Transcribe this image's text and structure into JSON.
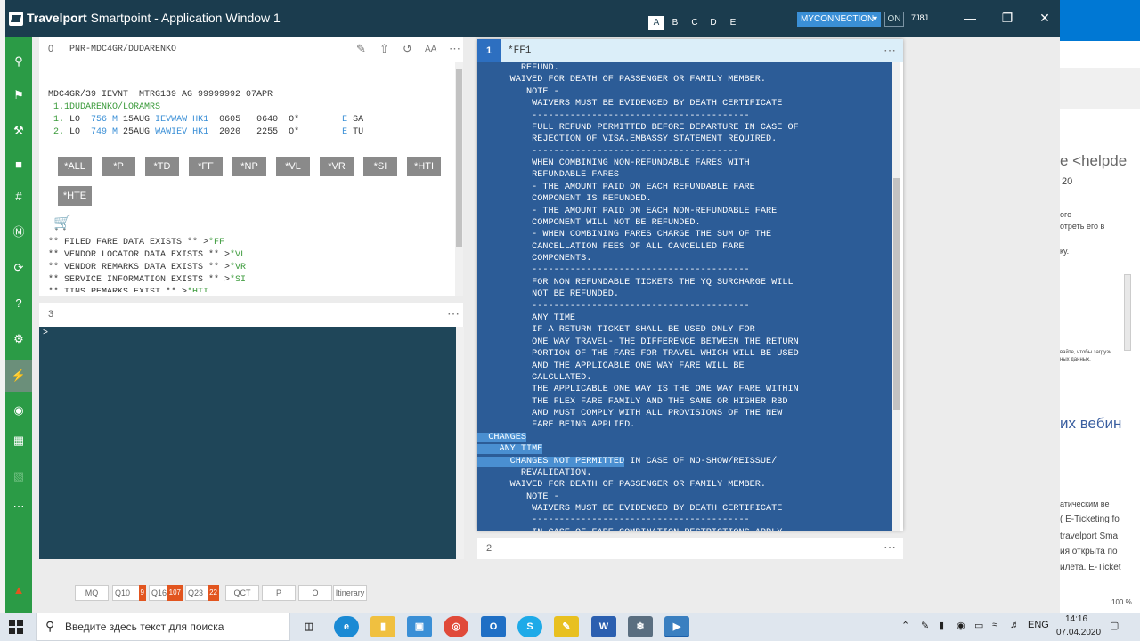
{
  "window": {
    "title_bold": "Travelport",
    "title_rest": " Smartpoint - Application Window 1",
    "workspaces": [
      "A",
      "B",
      "C",
      "D",
      "E"
    ],
    "connection": "MYCONNECTION",
    "on_label": "ON",
    "session_id": "7J8J"
  },
  "panel0": {
    "number": "0",
    "title": "PNR-MDC4GR/DUDARENKO",
    "header_line": "MDC4GR/39 IEVNT  MTRG139 AG 99999992 07APR",
    "passenger": " 1.1DUDARENKO/LORAMRS",
    "segments": [
      {
        "num": " 1.",
        "carrier": "LO",
        "flight": "756 M",
        "date": "15AUG",
        "route": "IEVWAW",
        "status": "HK1",
        "dep": "0605",
        "arr": "0640",
        "o": "O*",
        "e": "E",
        "day": "SA"
      },
      {
        "num": " 2.",
        "carrier": "LO",
        "flight": "749 M",
        "date": "25AUG",
        "route": "WAWIEV",
        "status": "HK1",
        "dep": "2020",
        "arr": "2255",
        "o": "O*",
        "e": "E",
        "day": "TU"
      }
    ],
    "buttons": [
      "*ALL",
      "*P",
      "*TD",
      "*FF",
      "*NP",
      "*VL",
      "*VR",
      "*SI",
      "*HTI",
      "*HTE"
    ],
    "notes": [
      {
        "text": "** FILED FARE DATA EXISTS ** >",
        "link": "*FF"
      },
      {
        "text": "** VENDOR LOCATOR DATA EXISTS ** >",
        "link": "*VL"
      },
      {
        "text": "** VENDOR REMARKS DATA EXISTS ** >",
        "link": "*VR"
      },
      {
        "text": "** SERVICE INFORMATION EXISTS ** >",
        "link": "*SI"
      },
      {
        "text": "** TINS REMARKS EXIST ** >",
        "link": "*HTI"
      }
    ]
  },
  "panel3": {
    "number": "3",
    "prompt": ">"
  },
  "panel1": {
    "number": "1",
    "title": "*FF1",
    "lines": [
      "        REFUND.",
      "      WAIVED FOR DEATH OF PASSENGER OR FAMILY MEMBER.",
      "         NOTE -",
      "          WAIVERS MUST BE EVIDENCED BY DEATH CERTIFICATE",
      "          ----------------------------------------",
      "          FULL REFUND PERMITTED BEFORE DEPARTURE IN CASE OF",
      "          REJECTION OF VISA.EMBASSY STATEMENT REQUIRED.",
      "          --------------------------------------",
      "          WHEN COMBINING NON-REFUNDABLE FARES WITH",
      "          REFUNDABLE FARES",
      "          - THE AMOUNT PAID ON EACH REFUNDABLE FARE",
      "          COMPONENT IS REFUNDED.",
      "          - THE AMOUNT PAID ON EACH NON-REFUNDABLE FARE",
      "          COMPONENT WILL NOT BE REFUNDED.",
      "          - WHEN COMBINING FARES CHARGE THE SUM OF THE",
      "          CANCELLATION FEES OF ALL CANCELLED FARE",
      "          COMPONENTS.",
      "          ----------------------------------------",
      "          FOR NON REFUNDABLE TICKETS THE YQ SURCHARGE WILL",
      "          NOT BE REFUNDED.",
      "          ----------------------------------------",
      "          ANY TIME",
      "          IF A RETURN TICKET SHALL BE USED ONLY FOR",
      "          ONE WAY TRAVEL- THE DIFFERENCE BETWEEN THE RETURN",
      "          PORTION OF THE FARE FOR TRAVEL WHICH WILL BE USED",
      "          AND THE APPLICABLE ONE WAY FARE WILL BE",
      "          CALCULATED.",
      "          THE APPLICABLE ONE WAY IS THE ONE WAY FARE WITHIN",
      "          THE FLEX FARE FAMILY AND THE SAME OR HIGHER RBD",
      "          AND MUST COMPLY WITH ALL PROVISIONS OF THE NEW",
      "          FARE BEING APPLIED.",
      "  CHANGES",
      "    ANY TIME",
      "      CHANGES NOT PERMITTED IN CASE OF NO-SHOW/REISSUE/",
      "        REVALIDATION.",
      "      WAIVED FOR DEATH OF PASSENGER OR FAMILY MEMBER.",
      "         NOTE -",
      "          WAIVERS MUST BE EVIDENCED BY DEATH CERTIFICATE",
      "          ----------------------------------------",
      "          IN CASE OF FARE COMBINATION RESTRICTIONS APPLY"
    ]
  },
  "panel2": {
    "number": "2"
  },
  "bottombar": [
    {
      "label": "MQ"
    },
    {
      "label": "Q10",
      "count": "9"
    },
    {
      "label": "Q16",
      "count": "107"
    },
    {
      "label": "Q23",
      "count": "22"
    },
    {
      "label": "QCT"
    },
    {
      "label": "P"
    },
    {
      "label": "O"
    },
    {
      "label": "Itinerary"
    }
  ],
  "background_browser": {
    "lines": [
      "e <helpde",
      "20",
      "ого",
      "отреть его в",
      "ку.",
      "вайте, чтобы загрузи",
      "ных данных.",
      "их вебин",
      "атическим ве",
      "( E-Ticketing fo",
      "travelport Sma",
      "ия открыта по",
      "илета. E-Ticket",
      "100 %"
    ]
  },
  "taskbar": {
    "search_placeholder": "Введите здесь текст для поиска",
    "lang": "ENG",
    "time": "14:16",
    "date": "07.04.2020"
  }
}
